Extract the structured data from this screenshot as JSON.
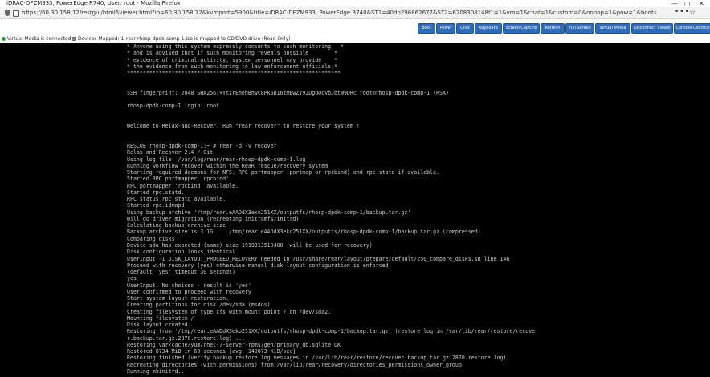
{
  "window": {
    "title": "iDRAC-DFZM933, PowerEdge R740, User: root - Mozilla Firefox",
    "controls": [
      "—",
      "□",
      "✕"
    ]
  },
  "browser": {
    "url": "https://60.30.158.12/restgui/html5viewer.html?ip=60.30.158.12&kvmport=5900&title=iDRAC-DFZM933, PowerEdge R740&ST1=40db296862677&ST2=6208308148f1=1&vm=1&chat=1&custom=0&nopop=1&pow=1&boot=1&attachstate=Attached&clipbit=0",
    "menu_glyph": "•••",
    "bookmark_glyph": "☆"
  },
  "toolbar": {
    "buttons": [
      {
        "label": "Boot"
      },
      {
        "label": "Power"
      },
      {
        "label": "Chat"
      },
      {
        "label": "Keyboard"
      },
      {
        "label": "Screen Capture"
      },
      {
        "label": "Refresh"
      },
      {
        "label": "Full Screen"
      },
      {
        "label": "Virtual Media"
      },
      {
        "label": "Disconnect Viewer"
      },
      {
        "label": "Console Controls"
      }
    ],
    "accent": "#2e6cb8"
  },
  "status": {
    "virtual_media": "Virtual Media is connected",
    "devices_mapped": "Devices Mapped: 1",
    "mapping": "rear-rhosp-dpdk-comp-1.iso is mapped to CD/DVD drive (Read Only)",
    "connected_color": "#2e9e3e"
  },
  "console": {
    "lines": [
      "* Anyone using this system expressly consents to such monitoring   *",
      "* and is advised that if such monitoring reveals possible        *",
      "* evidence of criminal activity, system personnel may provide    *",
      "* the evidence from such monitoring to law enforcement officials.*",
      "*******************************************************************",
      "",
      "",
      "SSH fingerprint: 2048 SHA256:+YtzrEhehBhwc8Pk5D16tMEwZY9JDgUQcVbJbtW9DRc root@rhosp-dpdk-comp-1 (RSA)",
      "",
      "rhosp-dpdk-comp-1 login: root",
      "",
      "",
      "Welcome to Relax-and-Recover. Run \"rear recover\" to restore your system !",
      "",
      "",
      "RESCUE rhosp-dpdk-comp-1:~ # rear -d -v recover",
      "Relax-and-Recover 2.4 / Git",
      "Using log file: /var/log/rear/rear-rhosp-dpdk-comp-1.log",
      "Running workflow recover within the ReaR rescue/recovery system",
      "Starting required daemons for NFS: RPC portmapper (portmap or rpcbind) and rpc.statd if available.",
      "Started RPC portmapper 'rpcbind'.",
      "RPC portmapper 'rpcbind' available.",
      "Started rpc.statd.",
      "RPC status rpc.statd available.",
      "Started rpc.idmapd.",
      "Using backup archive '/tmp/rear.eAADdX3eko251XX/outputfs/rhosp-dpdk-comp-1/backup.tar.gz'",
      "Will do driver migration (recreating initramfs/initrd)",
      "Calculating backup archive size",
      "Backup archive size is 3.1G     /tmp/rear.eAADdX3eko251XX/outputfs/rhosp-dpdk-comp-1/backup.tar.gz (compressed)",
      "Comparing disks",
      "Device sda has expected (same) size 1919313510400 (will be used for recovery)",
      "Disk configuration looks identical",
      "UserInput -I DISK_LAYOUT_PROCEED_RECOVERY needed in /usr/share/rear/layout/prepare/default/250_compare_disks.sh line 146",
      "Proceed with recovery (yes) otherwise manual disk layout configuration is enforced",
      "(default 'yes' timeout 30 seconds)",
      "yes",
      "UserInput: No choices - result is 'yes'",
      "User confirmed to proceed with recovery",
      "Start system layout restoration.",
      "Creating partitions for disk /dev/sda (msdos)",
      "Creating filesystem of type xfs with mount point / on /dev/sda2.",
      "Mounting filesystem /",
      "Disk layout created.",
      "Restoring from '/tmp/rear.eAADdX3eko251XX/outputfs/rhosp-dpdk-comp-1/backup.tar.gz' (restore log in /var/lib/rear/restore/recove",
      "r.backup.tar.gz.2870.restore.log) ...",
      "Restoring var/cache/yum/rhel-7-server-rpms/gen/primary_db.sqlite OK",
      "Restored 8734 MiB in 60 seconds [avg. 149073 KiB/sec]",
      "Restoring finished (verify backup restore log messages in /var/lib/rear/restore/recover.backup.tar.gz.2870.restore.log)",
      "Recreating directories (with permissions) from /var/lib/rear/recovery/directories_permissions_owner_group",
      "Running mkinitrd..."
    ]
  }
}
